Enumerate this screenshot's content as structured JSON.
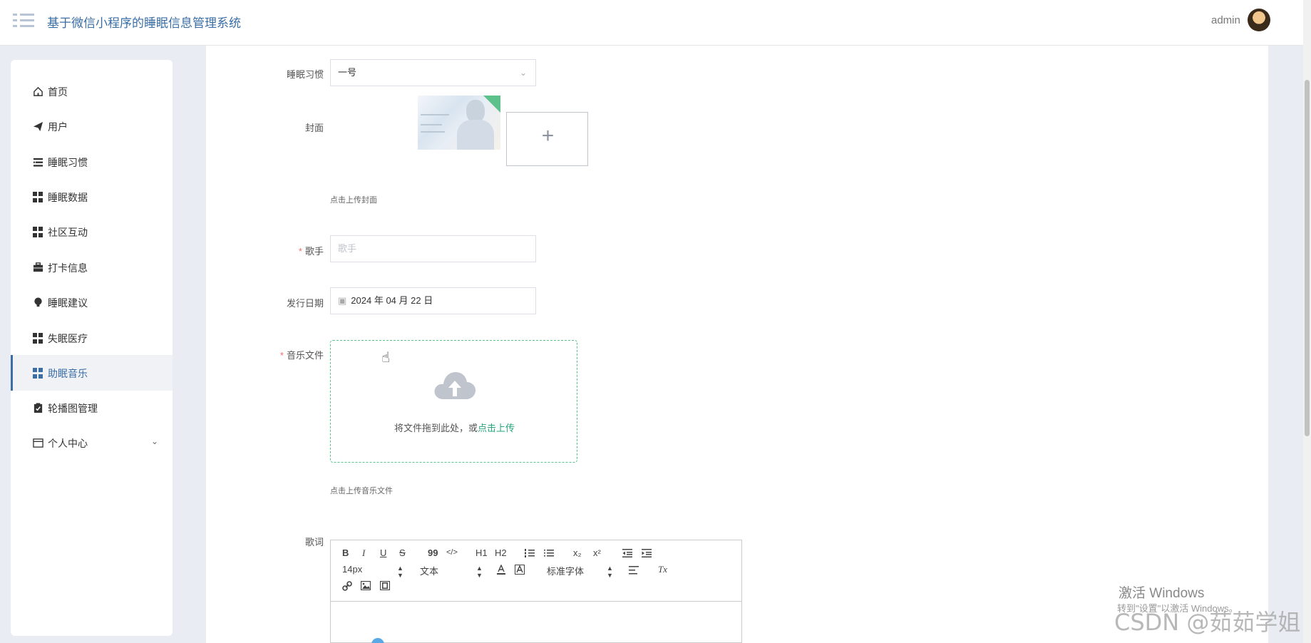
{
  "header": {
    "app_title": "基于微信小程序的睡眠信息管理系统",
    "user_name": "admin"
  },
  "sidebar": {
    "items": [
      {
        "label": "首页",
        "icon": "home-icon"
      },
      {
        "label": "用户",
        "icon": "paper-plane-icon"
      },
      {
        "label": "睡眠习惯",
        "icon": "list-icon"
      },
      {
        "label": "睡眠数据",
        "icon": "grid-icon"
      },
      {
        "label": "社区互动",
        "icon": "grid-icon"
      },
      {
        "label": "打卡信息",
        "icon": "briefcase-icon"
      },
      {
        "label": "睡眠建议",
        "icon": "bulb-icon"
      },
      {
        "label": "失眠医疗",
        "icon": "grid-icon"
      },
      {
        "label": "助眠音乐",
        "icon": "grid-icon",
        "active": true
      },
      {
        "label": "轮播图管理",
        "icon": "clipboard-check-icon"
      },
      {
        "label": "个人中心",
        "icon": "card-icon",
        "expandable": true
      }
    ]
  },
  "form": {
    "habit_label": "睡眠习惯",
    "habit_value": "一号",
    "cover_label": "封面",
    "cover_tip": "点击上传封面",
    "singer_label": "歌手",
    "singer_placeholder": "歌手",
    "date_label": "发行日期",
    "date_value": "2024 年 04 月 22 日",
    "music_label": "音乐文件",
    "drop_text": "将文件拖到此处，或",
    "drop_link": "点击上传",
    "music_tip": "点击上传音乐文件",
    "lyrics_label": "歌词"
  },
  "editor": {
    "font_size": "14px",
    "text_type": "文本",
    "font_family": "标准字体",
    "bold": "B",
    "italic": "I",
    "underline": "U",
    "strike": "S",
    "quote": "99",
    "code": "</>",
    "h1": "H1",
    "h2": "H2",
    "sub": "x₂",
    "sup": "x²",
    "clean": "Tx"
  },
  "watermark": {
    "windows_title": "激活 Windows",
    "windows_sub": "转到\"设置\"以激活 Windows。",
    "csdn": "CSDN @茹茹学姐"
  },
  "colors": {
    "accent": "#3a6ea5",
    "upload_green": "#26a67a",
    "required": "#f56c6c"
  }
}
